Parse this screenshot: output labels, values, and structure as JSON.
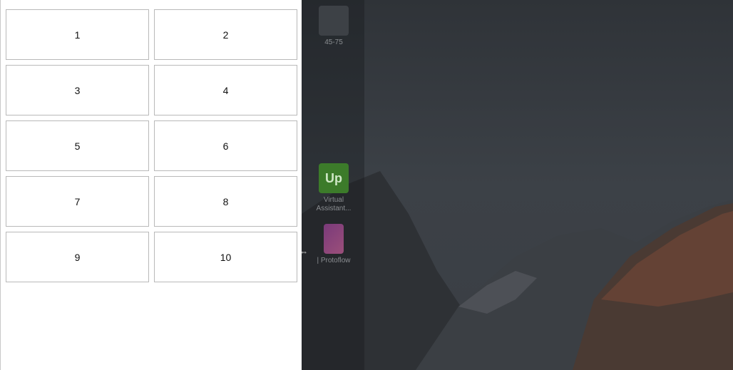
{
  "tiles": [
    "1",
    "2",
    "3",
    "4",
    "5",
    "6",
    "7",
    "8",
    "9",
    "10"
  ],
  "desktop": {
    "icons": [
      {
        "label": "45-75",
        "icon": "folder-icon"
      },
      {
        "label": "Virtual Assistant...",
        "icon": "upwork-icon",
        "glyph": "Up"
      },
      {
        "label": "| Protoflow",
        "icon": "protoflow-icon"
      }
    ]
  },
  "colors": {
    "panel_bg": "#ffffff",
    "tile_border": "#b9b9b9",
    "desktop_bg": "#363a3f",
    "upwork_green": "#3c7b2a",
    "protoflow_purple": "#7a3a7a",
    "mountain_glow": "#7a4a3a"
  }
}
